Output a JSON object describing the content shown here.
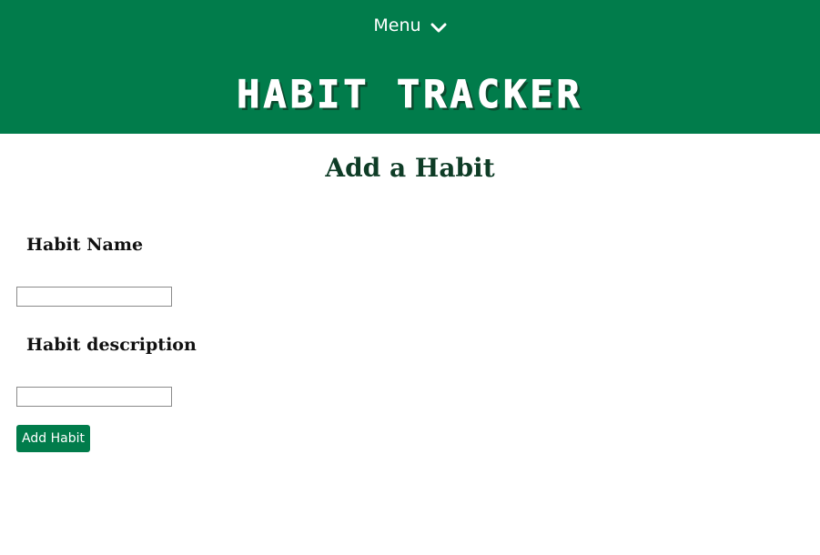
{
  "header": {
    "menu_label": "Menu",
    "menu_icon": "chevron-down-icon",
    "site_title": "Habit Tracker",
    "background_color": "#017c4b"
  },
  "main": {
    "heading": "Add a Habit",
    "heading_color": "#0e3c26",
    "form": {
      "name_label": "Habit Name",
      "name_value": "",
      "description_label": "Habit description",
      "description_value": "",
      "submit_label": "Add Habit",
      "submit_color": "#017c4b"
    }
  }
}
